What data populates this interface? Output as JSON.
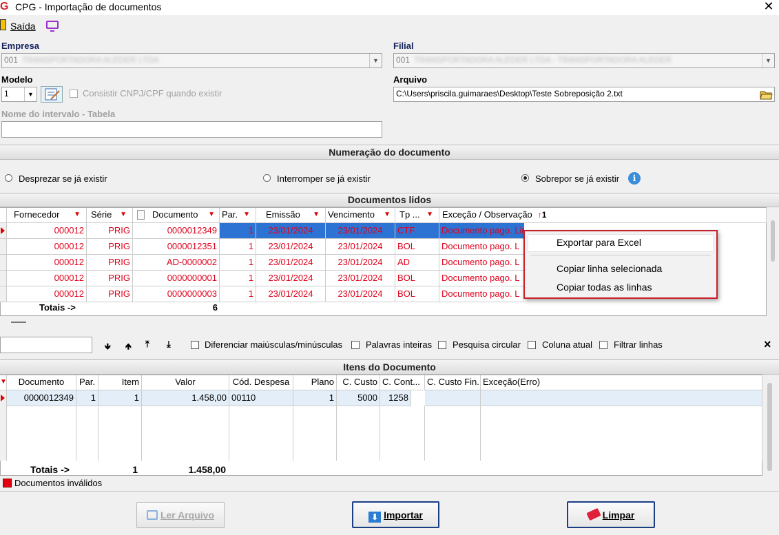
{
  "window": {
    "title": "CPG - Importação de documentos",
    "logo": "G",
    "close_glyph": "✕"
  },
  "toolbar": {
    "exit_label": "Saída"
  },
  "empresa": {
    "label": "Empresa",
    "value": "001",
    "masked": "TRANSPORTADORA ALEDER LTDA"
  },
  "filial": {
    "label": "Filial",
    "value": "001",
    "masked": "TRANSPORTADORA ALEDER LTDA - TRANSPORTADORA ALEDER"
  },
  "modelo": {
    "label": "Modelo",
    "value": "1",
    "check_label": "Consistir CNPJ/CPF quando existir"
  },
  "arquivo": {
    "label": "Arquivo",
    "value": "C:\\Users\\priscila.guimaraes\\Desktop\\Teste Sobreposição 2.txt"
  },
  "intervalo": {
    "label": "Nome do intervalo - Tabela",
    "value": ""
  },
  "numeracao": {
    "title": "Numeração do documento",
    "options": [
      "Desprezar se já existir",
      "Interromper se já existir",
      "Sobrepor se já existir"
    ],
    "selected": "Sobrepor se já existir",
    "info_glyph": "i"
  },
  "docs": {
    "title": "Documentos lidos",
    "columns": [
      "Fornecedor",
      "Série",
      "Documento",
      "Par.",
      "Emissão",
      "Vencimento",
      "Tp ...",
      "Exceção / Observação"
    ],
    "sort_badge": "1",
    "rows": [
      {
        "fornecedor": "000012",
        "serie": "PRIG",
        "documento": "0000012349",
        "par": "1",
        "emissao": "23/01/2024",
        "vencimento": "23/01/2024",
        "tp": "CTF",
        "excecao": "Documento pago. Linha 1"
      },
      {
        "fornecedor": "000012",
        "serie": "PRIG",
        "documento": "0000012351",
        "par": "1",
        "emissao": "23/01/2024",
        "vencimento": "23/01/2024",
        "tp": "BOL",
        "excecao": "Documento pago. L"
      },
      {
        "fornecedor": "000012",
        "serie": "PRIG",
        "documento": "AD-0000002",
        "par": "1",
        "emissao": "23/01/2024",
        "vencimento": "23/01/2024",
        "tp": "AD",
        "excecao": "Documento pago. L"
      },
      {
        "fornecedor": "000012",
        "serie": "PRIG",
        "documento": "0000000001",
        "par": "1",
        "emissao": "23/01/2024",
        "vencimento": "23/01/2024",
        "tp": "BOL",
        "excecao": "Documento pago. L"
      },
      {
        "fornecedor": "000012",
        "serie": "PRIG",
        "documento": "0000000003",
        "par": "1",
        "emissao": "23/01/2024",
        "vencimento": "23/01/2024",
        "tp": "BOL",
        "excecao": "Documento pago. L"
      }
    ],
    "totals_label": "Totais ->",
    "totals_count": "6"
  },
  "context_menu": {
    "items": [
      "Exportar para Excel",
      "Copiar linha selecionada",
      "Copiar todas as linhas"
    ]
  },
  "search": {
    "value": "",
    "options": [
      "Diferenciar maiúsculas/minúsculas",
      "Palavras inteiras",
      "Pesquisa circular",
      "Coluna atual",
      "Filtrar linhas"
    ],
    "close_glyph": "×"
  },
  "itens": {
    "title": "Itens do Documento",
    "columns": [
      "Documento",
      "Par.",
      "Item",
      "Valor",
      "Cód. Despesa",
      "Plano",
      "C. Custo",
      "C. Cont...",
      "C. Custo Fin.",
      "Exceção(Erro)"
    ],
    "rows": [
      {
        "documento": "0000012349",
        "par": "1",
        "item": "1",
        "valor": "1.458,00",
        "cod_despesa": "00110",
        "plano": "1",
        "c_custo": "5000",
        "c_cont": "1258",
        "c_custo_fin": "",
        "excecao": ""
      }
    ],
    "totals_label": "Totais ->",
    "totals_item": "1",
    "totals_valor": "1.458,00"
  },
  "legend": {
    "label": "Documentos inválidos",
    "color": "#e00010"
  },
  "buttons": {
    "ler": "Ler Arquivo",
    "importar": "Importar",
    "limpar": "Limpar"
  }
}
